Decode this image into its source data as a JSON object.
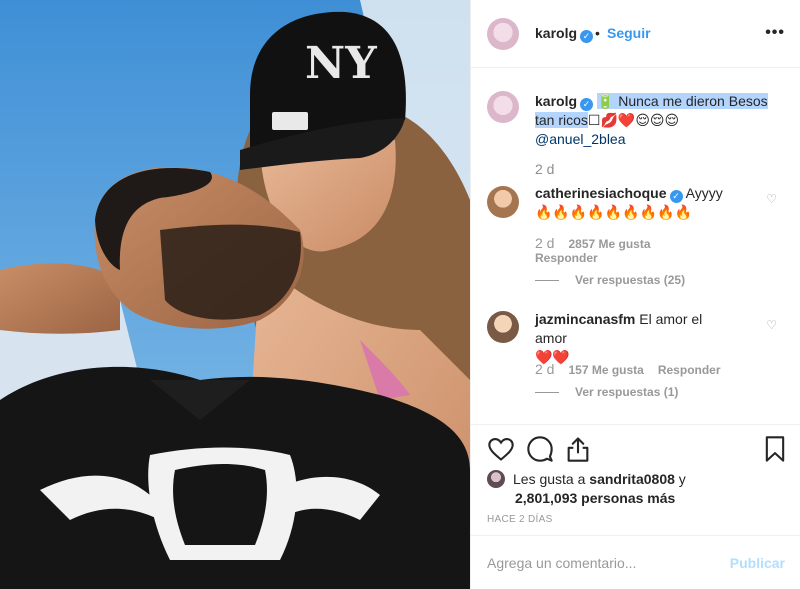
{
  "header": {
    "username": "karolg",
    "verified_mark": "✓",
    "separator": "•",
    "follow_label": "Seguir",
    "more_label": "•••"
  },
  "caption": {
    "username": "karolg",
    "verified_mark": "✓",
    "text": "🔋 Nunca me dieron Besos tan ricos",
    "emojis": "☐💋❤️😌😌😌",
    "mention": "@anuel_2blea",
    "time": "2 d"
  },
  "comments": [
    {
      "username": "catherinesiachoque",
      "verified_mark": "✓",
      "text": "Ayyyy",
      "emojis": "🔥🔥🔥🔥🔥🔥🔥🔥🔥",
      "time": "2 d",
      "likes": "2857 Me gusta",
      "reply_label": "Responder",
      "view_replies": "Ver respuestas (25)"
    },
    {
      "username": "jazmincanasfm",
      "text": "El amor el amor",
      "emojis": "❤️❤️",
      "time": "2 d",
      "likes": "157 Me gusta",
      "reply_label": "Responder",
      "view_replies": "Ver respuestas (1)"
    }
  ],
  "actions": {
    "like_icon": "heart-icon",
    "comment_icon": "comment-icon",
    "share_icon": "share-icon",
    "save_icon": "bookmark-icon"
  },
  "likes": {
    "prefix": "Les gusta a",
    "user": "sandrita0808",
    "connector": "y",
    "count": "2,801,093 personas más"
  },
  "posted_ago": "HACE 2 DÍAS",
  "composer": {
    "placeholder": "Agrega un comentario...",
    "publish_label": "Publicar"
  },
  "colors": {
    "link_blue": "#3897f0",
    "publish_disabled": "#b2dffc",
    "selection_highlight": "#b3d4fc",
    "muted_text": "#999999"
  }
}
